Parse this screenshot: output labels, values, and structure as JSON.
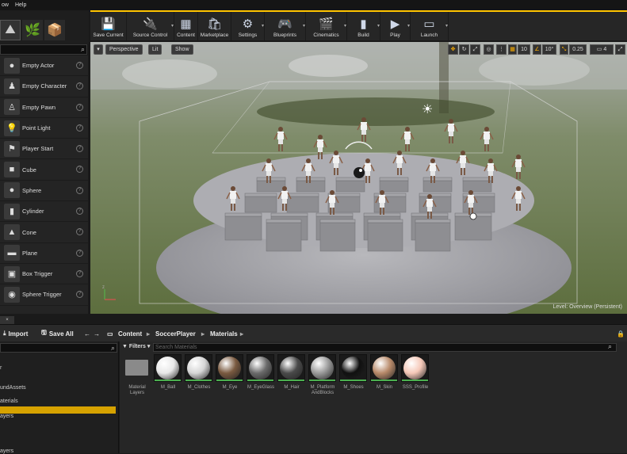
{
  "menu": [
    "ow",
    "Help"
  ],
  "toolbar": [
    {
      "label": "Save Current",
      "icon": "save-icon",
      "glyph": "💾"
    },
    {
      "label": "Source Control",
      "icon": "source-control-icon",
      "glyph": "🔌"
    },
    {
      "label": "Content",
      "icon": "content-icon",
      "glyph": "▦"
    },
    {
      "label": "Marketplace",
      "icon": "marketplace-icon",
      "glyph": "🛍"
    },
    {
      "label": "Settings",
      "icon": "settings-icon",
      "glyph": "⚙"
    },
    {
      "label": "Blueprints",
      "icon": "blueprints-icon",
      "glyph": "🎮"
    },
    {
      "label": "Cinematics",
      "icon": "cinematics-icon",
      "glyph": "🎬"
    },
    {
      "label": "Build",
      "icon": "build-icon",
      "glyph": "▮"
    },
    {
      "label": "Play",
      "icon": "play-icon",
      "glyph": "▶"
    },
    {
      "label": "Launch",
      "icon": "launch-icon",
      "glyph": "▭"
    }
  ],
  "place_items": [
    {
      "label": "Empty Actor",
      "icon": "sphere-actor-icon",
      "glyph": "●"
    },
    {
      "label": "Empty Character",
      "icon": "character-icon",
      "glyph": "♟"
    },
    {
      "label": "Empty Pawn",
      "icon": "pawn-icon",
      "glyph": "♙"
    },
    {
      "label": "Point Light",
      "icon": "point-light-icon",
      "glyph": "💡"
    },
    {
      "label": "Player Start",
      "icon": "player-start-icon",
      "glyph": "⚑"
    },
    {
      "label": "Cube",
      "icon": "cube-icon",
      "glyph": "■"
    },
    {
      "label": "Sphere",
      "icon": "sphere-icon",
      "glyph": "●"
    },
    {
      "label": "Cylinder",
      "icon": "cylinder-icon",
      "glyph": "▮"
    },
    {
      "label": "Cone",
      "icon": "cone-icon",
      "glyph": "▲"
    },
    {
      "label": "Plane",
      "icon": "plane-icon",
      "glyph": "▬"
    },
    {
      "label": "Box Trigger",
      "icon": "box-trigger-icon",
      "glyph": "▣"
    },
    {
      "label": "Sphere Trigger",
      "icon": "sphere-trigger-icon",
      "glyph": "◉"
    }
  ],
  "viewport": {
    "perspective": "Perspective",
    "lit": "Lit",
    "show": "Show",
    "grid_snap": "10",
    "rot_snap": "10°",
    "scale_snap": "0.25",
    "cam_speed": "4",
    "level": "Level:  Overview (Persistent)"
  },
  "content_browser": {
    "import": "Import",
    "save_all": "Save All",
    "path": [
      "Content",
      "SoccerPlayer",
      "Materials"
    ],
    "filters": "Filters",
    "search_placeholder": "Search Materials",
    "tree": [
      "r",
      "undAssets",
      "aterials",
      "ayers",
      "ayers"
    ]
  },
  "assets": [
    {
      "label": "Material Layers",
      "color": "#8a8a8a",
      "kind": "folder"
    },
    {
      "label": "M_Ball",
      "color": "#e8e8e8"
    },
    {
      "label": "M_Clothes",
      "color": "#d6d6d6"
    },
    {
      "label": "M_Eye",
      "color": "#7a5a40"
    },
    {
      "label": "M_EyeGlass",
      "color": "#6b6b6b"
    },
    {
      "label": "M_Hair",
      "color": "#4a4a4a"
    },
    {
      "label": "M_Platform AndBlocks",
      "color": "#9a9a9a"
    },
    {
      "label": "M_Shoes",
      "color": "#101010"
    },
    {
      "label": "M_Skin",
      "color": "#b88a6a"
    },
    {
      "label": "SSS_Profile",
      "color": "#f5c8b8"
    }
  ]
}
